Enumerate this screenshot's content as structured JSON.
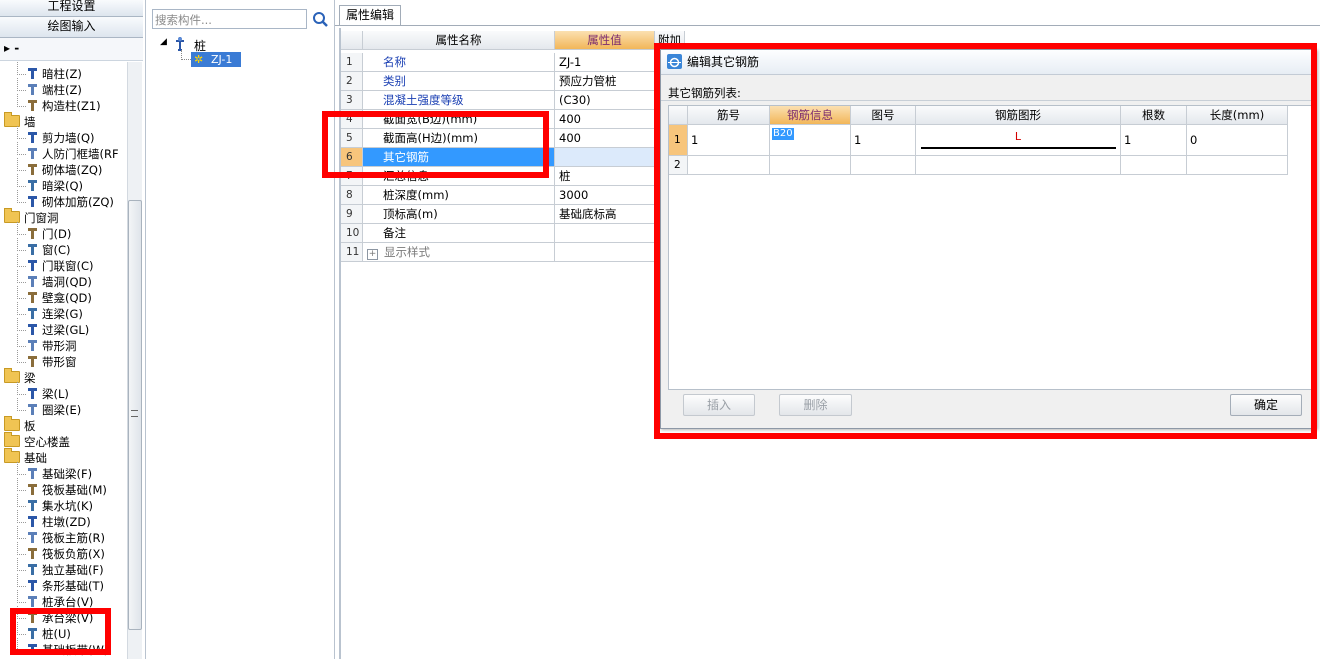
{
  "left_panel": {
    "top_buttons": [
      "工程设置",
      "绘图输入"
    ],
    "items": [
      {
        "label": "暗柱(Z)",
        "type": "child",
        "icon": "hidden-column-icon"
      },
      {
        "label": "端柱(Z)",
        "type": "child",
        "icon": "end-column-icon"
      },
      {
        "label": "构造柱(Z1)",
        "type": "child",
        "icon": "structural-column-icon"
      },
      {
        "label": "墙",
        "type": "folder"
      },
      {
        "label": "剪力墙(Q)",
        "type": "child",
        "icon": "shear-wall-icon"
      },
      {
        "label": "人防门框墙(RF",
        "type": "child",
        "icon": "civil-defense-wall-icon"
      },
      {
        "label": "砌体墙(ZQ)",
        "type": "child",
        "icon": "masonry-wall-icon"
      },
      {
        "label": "暗梁(Q)",
        "type": "child",
        "icon": "hidden-beam-icon"
      },
      {
        "label": "砌体加筋(ZQ)",
        "type": "child",
        "icon": "masonry-rebar-icon"
      },
      {
        "label": "门窗洞",
        "type": "folder"
      },
      {
        "label": "门(D)",
        "type": "child",
        "icon": "door-icon"
      },
      {
        "label": "窗(C)",
        "type": "child",
        "icon": "window-icon"
      },
      {
        "label": "门联窗(C)",
        "type": "child",
        "icon": "door-window-icon"
      },
      {
        "label": "墙洞(QD)",
        "type": "child",
        "icon": "wall-hole-icon"
      },
      {
        "label": "壁龛(QD)",
        "type": "child",
        "icon": "niche-icon"
      },
      {
        "label": "连梁(G)",
        "type": "child",
        "icon": "coupling-beam-icon"
      },
      {
        "label": "过梁(GL)",
        "type": "child",
        "icon": "lintel-icon"
      },
      {
        "label": "带形洞",
        "type": "child",
        "icon": "strip-hole-icon"
      },
      {
        "label": "带形窗",
        "type": "child",
        "icon": "strip-window-icon"
      },
      {
        "label": "梁",
        "type": "folder"
      },
      {
        "label": "梁(L)",
        "type": "child",
        "icon": "beam-icon"
      },
      {
        "label": "圈梁(E)",
        "type": "child",
        "icon": "ring-beam-icon"
      },
      {
        "label": "板",
        "type": "folder"
      },
      {
        "label": "空心楼盖",
        "type": "folder"
      },
      {
        "label": "基础",
        "type": "folder"
      },
      {
        "label": "基础梁(F)",
        "type": "child",
        "icon": "foundation-beam-icon"
      },
      {
        "label": "筏板基础(M)",
        "type": "child",
        "icon": "raft-foundation-icon"
      },
      {
        "label": "集水坑(K)",
        "type": "child",
        "icon": "sump-pit-icon"
      },
      {
        "label": "柱墩(ZD)",
        "type": "child",
        "icon": "column-pier-icon"
      },
      {
        "label": "筏板主筋(R)",
        "type": "child",
        "icon": "raft-main-rebar-icon"
      },
      {
        "label": "筏板负筋(X)",
        "type": "child",
        "icon": "raft-neg-rebar-icon"
      },
      {
        "label": "独立基础(F)",
        "type": "child",
        "icon": "isolated-footing-icon"
      },
      {
        "label": "条形基础(T)",
        "type": "child",
        "icon": "strip-footing-icon"
      },
      {
        "label": "桩承台(V)",
        "type": "child",
        "icon": "pile-cap-icon"
      },
      {
        "label": "承台梁(V)",
        "type": "child",
        "icon": "cap-beam-icon"
      },
      {
        "label": "桩(U)",
        "type": "child",
        "icon": "pile-icon"
      },
      {
        "label": "基础板带(W)",
        "type": "child",
        "icon": "foundation-strip-icon"
      }
    ]
  },
  "component_tree": {
    "search_placeholder": "搜索构件...",
    "root": "桩",
    "child": "ZJ-1"
  },
  "property_panel": {
    "tab_label": "属性编辑",
    "columns": [
      "属性名称",
      "属性值",
      "附加"
    ],
    "rows": [
      {
        "num": "1",
        "name": "名称",
        "value": "ZJ-1",
        "blue": true
      },
      {
        "num": "2",
        "name": "类别",
        "value": "预应力管桩",
        "blue": true
      },
      {
        "num": "3",
        "name": "混凝土强度等级",
        "value": "(C30)",
        "blue": true
      },
      {
        "num": "4",
        "name": "截面宽(B边)(mm)",
        "value": "400",
        "blue": false
      },
      {
        "num": "5",
        "name": "截面高(H边)(mm)",
        "value": "400",
        "blue": false
      },
      {
        "num": "6",
        "name": "其它钢筋",
        "value": "",
        "blue": false,
        "selected": true
      },
      {
        "num": "7",
        "name": "汇总信息",
        "value": "桩",
        "blue": false
      },
      {
        "num": "8",
        "name": "桩深度(mm)",
        "value": "3000",
        "blue": false
      },
      {
        "num": "9",
        "name": "顶标高(m)",
        "value": "基础底标高",
        "blue": false
      },
      {
        "num": "10",
        "name": "备注",
        "value": "",
        "blue": false
      },
      {
        "num": "11",
        "name": "显示样式",
        "value": "",
        "blue": false,
        "expander": "+"
      }
    ]
  },
  "dialog": {
    "title": "编辑其它钢筋",
    "list_label": "其它钢筋列表:",
    "columns": [
      "筋号",
      "钢筋信息",
      "图号",
      "钢筋图形",
      "根数",
      "长度(mm)"
    ],
    "rows": [
      {
        "num": "1",
        "bar_no": "1",
        "info": "B20",
        "fig_no": "1",
        "shape_label": "L",
        "count": "1",
        "length": "0"
      },
      {
        "num": "2",
        "bar_no": "",
        "info": "",
        "fig_no": "",
        "shape_label": "",
        "count": "",
        "length": ""
      }
    ],
    "buttons": {
      "insert": "插入",
      "delete": "删除",
      "ok": "确定"
    }
  },
  "colors": {
    "highlight_red": "#ff0000",
    "selected_row": "#3399ff",
    "header_orange": "#f7c57c"
  }
}
